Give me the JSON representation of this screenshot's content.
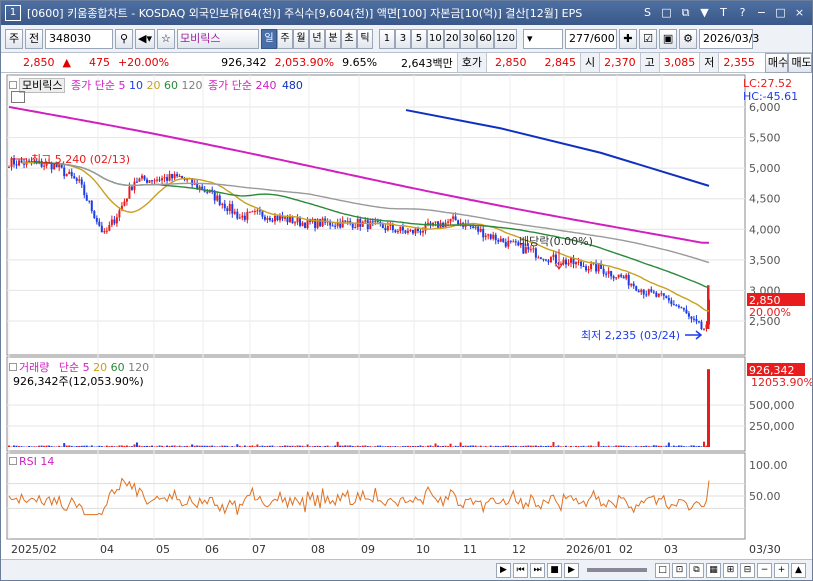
{
  "window": {
    "number": "1",
    "title": "[0600] 키움종합차트 - KOSDAQ 외국인보유[64(천)] 주식수[9,604(천)] 액면[100] 자본금[10(억)] 결산[12월] EPS",
    "icons": [
      "S",
      "□",
      "⧉",
      "▼",
      "T",
      "?",
      "−",
      "□",
      "×"
    ]
  },
  "toolbar": {
    "period_btn": "주",
    "prev_btn": "전",
    "code": "348030",
    "stock_name": "모비릭스",
    "periods": [
      "일",
      "주",
      "월",
      "년",
      "분",
      "초",
      "틱"
    ],
    "active_period": "일",
    "intervals": [
      "1",
      "3",
      "5",
      "10",
      "20",
      "30",
      "60",
      "120"
    ],
    "count": "277",
    "count_total": "/600",
    "date": "2026/03/3"
  },
  "quote": {
    "price": "2,850",
    "change": "475",
    "change_pct": "+20.00%",
    "volume": "926,342",
    "vol_pct": "2,053.90%",
    "turnover": "9.65%",
    "amount": "2,643백만",
    "bid_label": "호가",
    "ask": "2,850",
    "bid": "2,845",
    "open_label": "시",
    "open": "2,370",
    "high_label": "고",
    "high": "3,085",
    "low_label": "저",
    "low": "2,355",
    "buy_btn": "매수",
    "sell_btn": "매도"
  },
  "price_panel": {
    "legend_name": "모비릭스",
    "legend_ma": "종가 단순 5",
    "legend_ma_periods": [
      "10",
      "20",
      "60",
      "120"
    ],
    "legend_ma2": "종가 단순 240",
    "legend_ma2_period": "480",
    "lc": "LC:27.52",
    "hc": "HC:-45.61",
    "high_note": "최고 5,240 (02/13)",
    "low_note": "최저 2,235 (03/24)",
    "div_note": "배당락(0.00%)",
    "price_tag": "2,850",
    "pct_tag": "20.00%",
    "y_ticks": [
      "6,000",
      "5,500",
      "5,000",
      "4,500",
      "4,000",
      "3,500",
      "3,000",
      "2,500"
    ]
  },
  "volume_panel": {
    "legend": "거래량",
    "legend_ma": "단순 5",
    "legend_periods": [
      "20",
      "60",
      "120"
    ],
    "value_note": "926,342주(12,053.90%)",
    "tag_value": "926,342",
    "tag_pct": "12053.90%",
    "y_ticks": [
      "500,000",
      "250,000"
    ]
  },
  "rsi_panel": {
    "legend": "RSI 14",
    "y_ticks": [
      "100.00",
      "50.00"
    ]
  },
  "x_axis": [
    "2025/02",
    "04",
    "05",
    "06",
    "07",
    "08",
    "09",
    "10",
    "11",
    "12",
    "2026/01",
    "02",
    "03"
  ],
  "x_axis_right": "03/30",
  "colors": {
    "up": "#e81c1c",
    "down": "#1c3ce8",
    "ma5": "#c8a020",
    "ma20": "#2a8a3a",
    "ma60": "#808080",
    "ma240": "#d020c0",
    "ma480": "#1030c0"
  }
}
